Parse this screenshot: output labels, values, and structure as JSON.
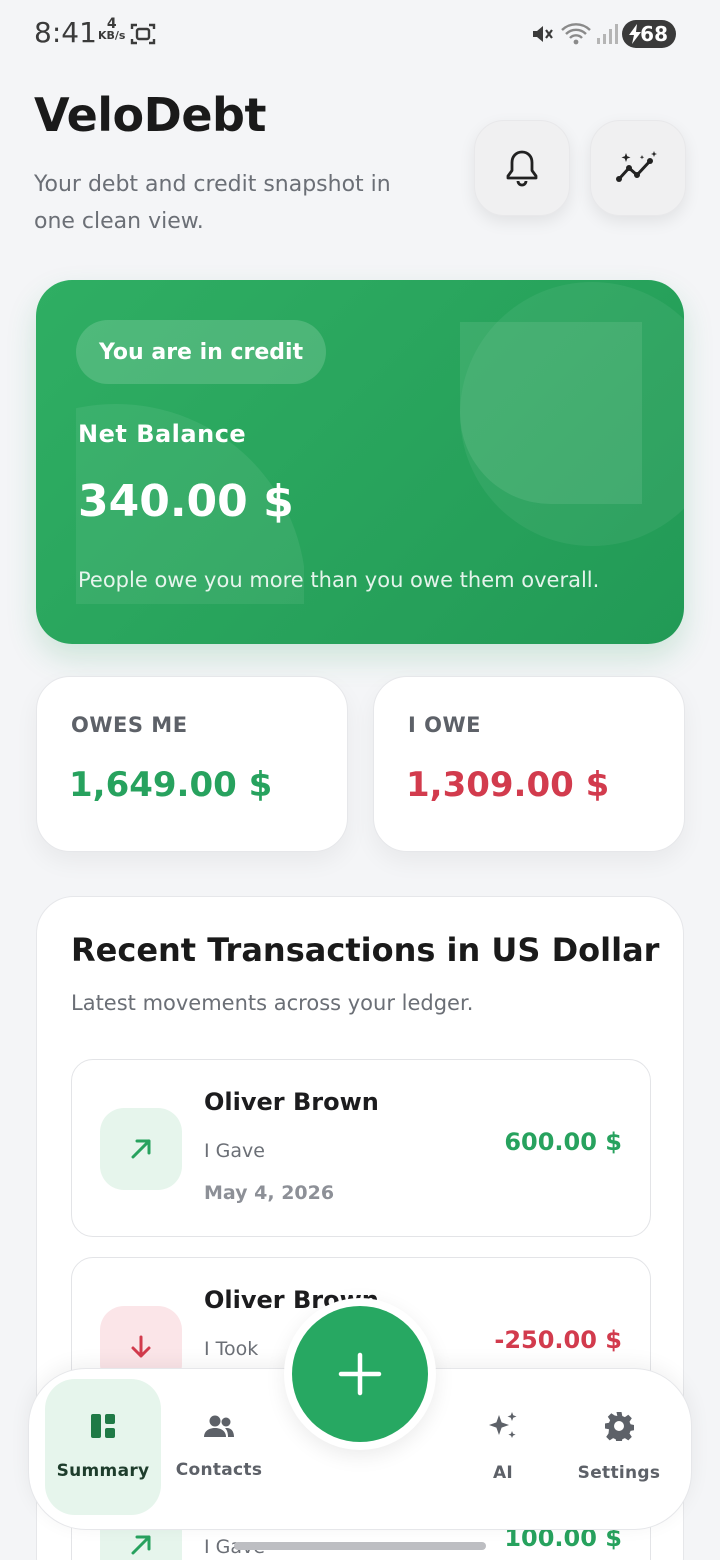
{
  "status_bar": {
    "time": "8:41",
    "net_speed_value": "4",
    "net_speed_unit": "KB/s",
    "battery": "68"
  },
  "header": {
    "title": "VeloDebt",
    "subtitle": "Your debt and credit snapshot in one clean view."
  },
  "balance_card": {
    "status_pill": "You are in credit",
    "label": "Net Balance",
    "amount": "340.00 $",
    "caption": "People owe you more than you owe them overall.",
    "color": "#2fae63"
  },
  "summary": {
    "owes_me_label": "OWES ME",
    "owes_me_value": "1,649.00 $",
    "i_owe_label": "I OWE",
    "i_owe_value": "1,309.00 $"
  },
  "transactions": {
    "title": "Recent Transactions in US Dollar",
    "subtitle": "Latest movements across your ledger.",
    "items": [
      {
        "name": "Oliver Brown",
        "kind": "I Gave",
        "date": "May 4, 2026",
        "amount": "600.00 $",
        "direction": "up"
      },
      {
        "name": "Oliver Brown",
        "kind": "I Took",
        "date": "",
        "amount": "-250.00 $",
        "direction": "down"
      },
      {
        "name": "",
        "kind": "I Gave",
        "date": "",
        "amount": "100.00 $",
        "direction": "up"
      }
    ]
  },
  "nav": {
    "summary": "Summary",
    "contacts": "Contacts",
    "ai": "AI",
    "settings": "Settings",
    "active": "Summary"
  },
  "colors": {
    "positive": "#27a25e",
    "negative": "#d23b4d",
    "accent": "#27a862"
  },
  "icons": {
    "notifications": "bell-icon",
    "insights": "sparkle-trend-icon",
    "fab": "plus-icon"
  }
}
